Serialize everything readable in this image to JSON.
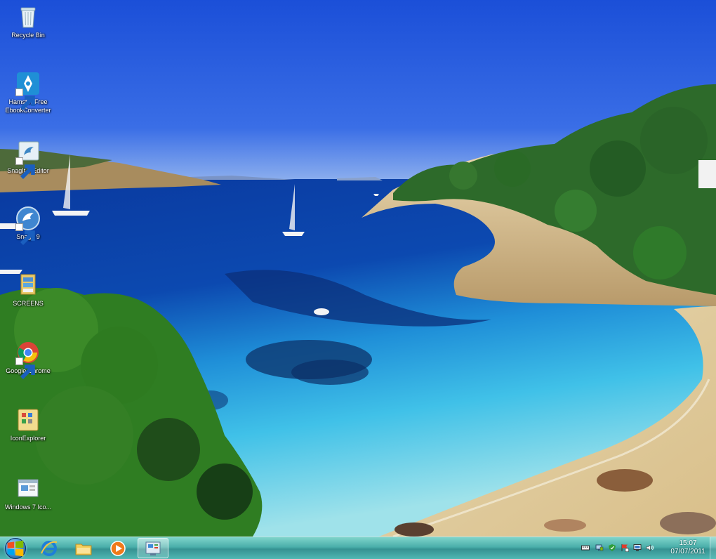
{
  "desktop_icons": [
    {
      "name": "recycle-bin",
      "label": "Recycle Bin"
    },
    {
      "name": "hamster-free-ebookconverter",
      "label": "Hamster Free EbookConverter"
    },
    {
      "name": "snagit-9-editor",
      "label": "SnagIt 9 Editor"
    },
    {
      "name": "snagit-9",
      "label": "SnagIt 9"
    },
    {
      "name": "screens",
      "label": "SCREENS"
    },
    {
      "name": "google-chrome",
      "label": "Google Chrome"
    },
    {
      "name": "iconexplorer",
      "label": "IconExplorer"
    },
    {
      "name": "windows-7",
      "label": "Windows 7 Ico..."
    }
  ],
  "taskbar": {
    "start_label": "Start",
    "pinned": [
      {
        "name": "internet-explorer",
        "icon": "ie-icon"
      },
      {
        "name": "windows-explorer",
        "icon": "folder-icon"
      },
      {
        "name": "windows-media-player",
        "icon": "media-player-icon"
      },
      {
        "name": "control-panel",
        "icon": "control-panel-icon",
        "active": true
      }
    ],
    "tray_icons": [
      "keyboard-icon",
      "network-icon",
      "security-icon",
      "flag-icon",
      "display-icon",
      "volume-icon"
    ],
    "clock": {
      "time": "15:07",
      "date": "07/07/2011"
    }
  },
  "colors": {
    "sky": "#2b5fe0",
    "sea_deep": "#0a3da0",
    "sea_shallow": "#3ec4e6",
    "sand": "#e7d3a5",
    "taskbar": "#45aaa6"
  }
}
